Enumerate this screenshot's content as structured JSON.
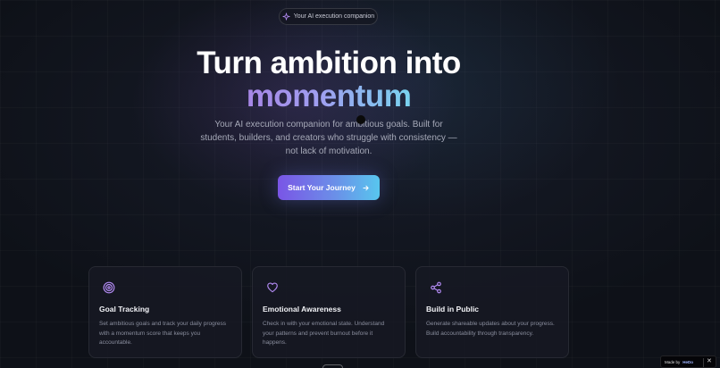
{
  "badge": {
    "label": "Your AI execution companion",
    "icon": "sparkle-icon"
  },
  "hero": {
    "title_line1": "Turn ambition into",
    "title_line2": "momentum",
    "subtitle": "Your AI execution companion for ambitious goals. Built for students, builders, and creators who struggle with consistency — not lack of motivation.",
    "cta_label": "Start Your Journey",
    "cta_icon": "arrow-right-icon"
  },
  "features": [
    {
      "icon": "target-icon",
      "title": "Goal Tracking",
      "description": "Set ambitious goals and track your daily progress with a momentum score that keeps you accountable."
    },
    {
      "icon": "heart-icon",
      "title": "Emotional Awareness",
      "description": "Check in with your emotional state. Understand your patterns and prevent burnout before it happens."
    },
    {
      "icon": "share-icon",
      "title": "Build in Public",
      "description": "Generate shareable updates about your progress. Build accountability through transparency."
    }
  ],
  "made_by": {
    "label": "Made by",
    "brand": "HeDo",
    "close": "✕"
  },
  "colors": {
    "accent_purple": "#7a55e6",
    "accent_cyan": "#58c6ee",
    "icon_purple": "#b48cf5"
  }
}
